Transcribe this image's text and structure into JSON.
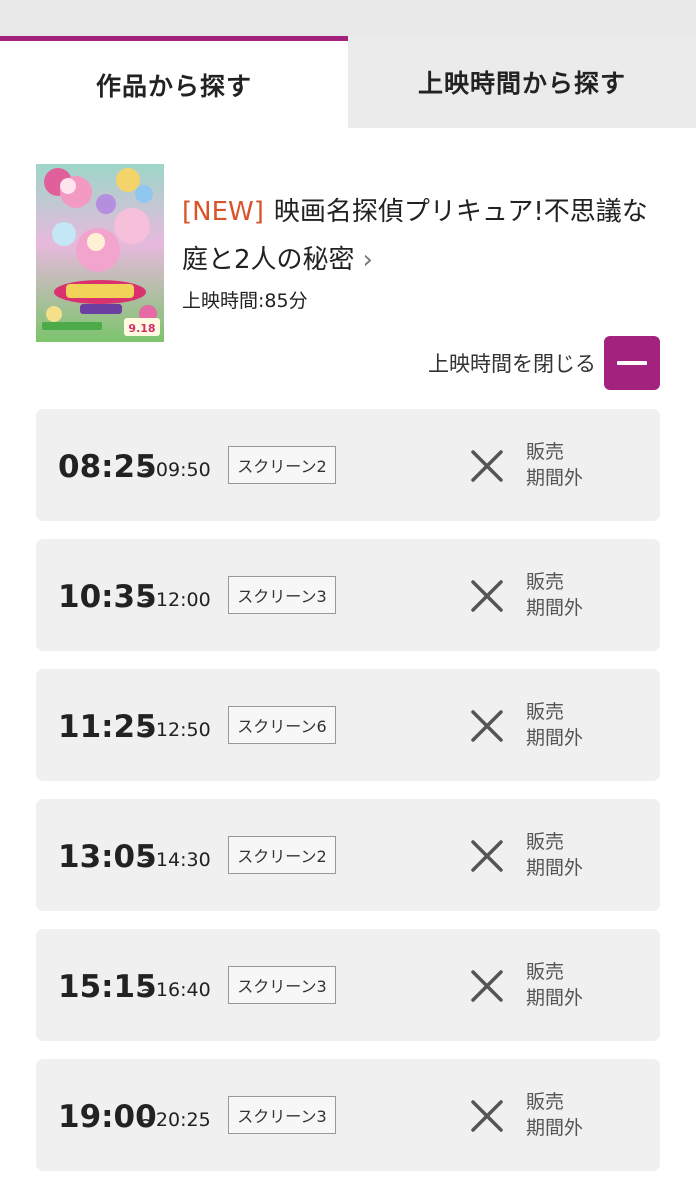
{
  "tabs": {
    "by_title": "作品から探す",
    "by_showtime": "上映時間から探す"
  },
  "movie": {
    "new_label": "[NEW]",
    "title": "映画名探偵プリキュア!不思議な庭と2人の秘密",
    "chevron": "›",
    "duration": "上映時間:85分",
    "poster_date_text": "9.18"
  },
  "close_showtimes_label": "上映時間を閉じる",
  "showtimes": [
    {
      "start": "08:25",
      "end": "~09:50",
      "screen": "スクリーン2",
      "status_line1": "販売",
      "status_line2": "期間外"
    },
    {
      "start": "10:35",
      "end": "~12:00",
      "screen": "スクリーン3",
      "status_line1": "販売",
      "status_line2": "期間外"
    },
    {
      "start": "11:25",
      "end": "~12:50",
      "screen": "スクリーン6",
      "status_line1": "販売",
      "status_line2": "期間外"
    },
    {
      "start": "13:05",
      "end": "~14:30",
      "screen": "スクリーン2",
      "status_line1": "販売",
      "status_line2": "期間外"
    },
    {
      "start": "15:15",
      "end": "~16:40",
      "screen": "スクリーン3",
      "status_line1": "販売",
      "status_line2": "期間外"
    },
    {
      "start": "19:00",
      "end": "~20:25",
      "screen": "スクリーン3",
      "status_line1": "販売",
      "status_line2": "期間外"
    }
  ],
  "icons": {
    "unavailable": "x-icon",
    "collapse": "minus-icon"
  },
  "colors": {
    "accent": "#a3227e",
    "new_tag": "#d8542a",
    "card_bg": "#f0f0f0"
  }
}
